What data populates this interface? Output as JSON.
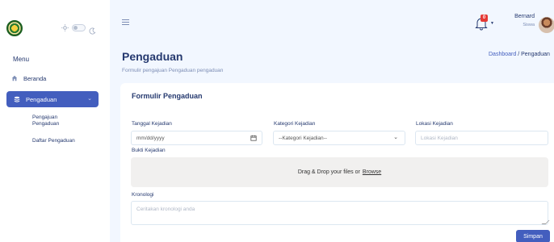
{
  "sidebar": {
    "menu_title": "Menu",
    "items": [
      {
        "label": "Beranda",
        "icon": "home-icon"
      },
      {
        "label": "Pengaduan",
        "icon": "stack-icon",
        "active": true
      }
    ],
    "sub_items": [
      {
        "label": "Pengajuan Pengaduan"
      },
      {
        "label": "Daftar Pengaduan"
      }
    ]
  },
  "header": {
    "notification_count": "0",
    "user_name": "Bernard",
    "user_role": "Siswa"
  },
  "page": {
    "title": "Pengaduan",
    "subtitle": "Formulir pengajuan Pengaduan pengaduan",
    "breadcrumb": {
      "home": "Dashboard",
      "separator": "/",
      "current": "Pengaduan"
    }
  },
  "form": {
    "card_title": "Formulir Pengaduan",
    "tanggal": {
      "label": "Tanggal Kejadian",
      "value": "mm/dd/yyyy"
    },
    "kategori": {
      "label": "Kategori Kejadian",
      "value": "--Kategori Kejadian--"
    },
    "lokasi": {
      "label": "Lokasi Kejadian",
      "placeholder": "Lokasi Kejadian"
    },
    "bukti": {
      "label": "Bukti Kejadian",
      "dropzone_text": "Drag & Drop your files or",
      "browse_label": "Browse"
    },
    "kronologi": {
      "label": "Kronologi",
      "placeholder": "Ceritakan kronologi anda"
    },
    "submit_label": "Simpan"
  },
  "colors": {
    "primary": "#435ebe",
    "background": "#f2f7ff",
    "text": "#25396f",
    "badge": "#e53935"
  }
}
